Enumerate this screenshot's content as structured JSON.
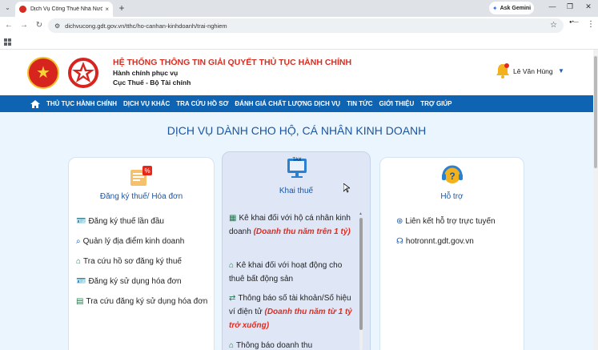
{
  "browser": {
    "tab_title": "Dịch Vụ Công Thuế Nhà Nước",
    "tab_close": "×",
    "new_tab": "+",
    "gemini_label": "Ask Gemini",
    "url": "dichvucong.gdt.gov.vn/tthc/ho-canhan-kinhdoanh/trai-nghiem",
    "min": "—",
    "max": "❐",
    "close": "✕"
  },
  "header": {
    "title": "HỆ THỐNG THÔNG TIN GIẢI QUYẾT THỦ TỤC HÀNH CHÍNH",
    "sub1": "Hành chính phục vụ",
    "sub2": "Cục Thuế - Bộ Tài chính",
    "user_name": "Lê Văn Hùng"
  },
  "nav": {
    "items": [
      "THỦ TỤC HÀNH CHÍNH",
      "DỊCH VỤ KHÁC",
      "TRA CỨU HỒ SƠ",
      "ĐÁNH GIÁ CHẤT LƯỢNG DỊCH VỤ",
      "TIN TỨC",
      "GIỚI THIỆU",
      "TRỢ GIÚP"
    ]
  },
  "section_title": "DỊCH VỤ DÀNH CHO HỘ, CÁ NHÂN KINH DOANH",
  "cards": {
    "register": {
      "title": "Đăng ký thuế/ Hóa đơn",
      "items": [
        "Đăng ký thuế lần đầu",
        "Quản lý địa điểm kinh doanh",
        "Tra cứu hồ sơ đăng ký thuế",
        "Đăng ký sử dụng hóa đơn",
        "Tra cứu đăng ký sử dụng hóa đơn"
      ]
    },
    "declare": {
      "title": "Khai thuế",
      "icon_text": "TAX",
      "i1": "Kê khai đối với hộ cá nhân kinh doanh ",
      "i1_hl": "(Doanh thu năm trên 1 tỷ)",
      "i2": "Kê khai đối với hoạt động cho thuê bất động sản",
      "i3": "Thông báo số tài khoản/Số hiệu ví điện tử ",
      "i3_hl": "(Doanh thu năm từ 1 tỷ trở xuống)",
      "i4": "Thông báo doanh thu"
    },
    "support": {
      "title": "Hỗ trợ",
      "items": [
        "Liên kết hỗ trợ trực tuyến",
        "hotronnt.gdt.gov.vn"
      ]
    }
  }
}
